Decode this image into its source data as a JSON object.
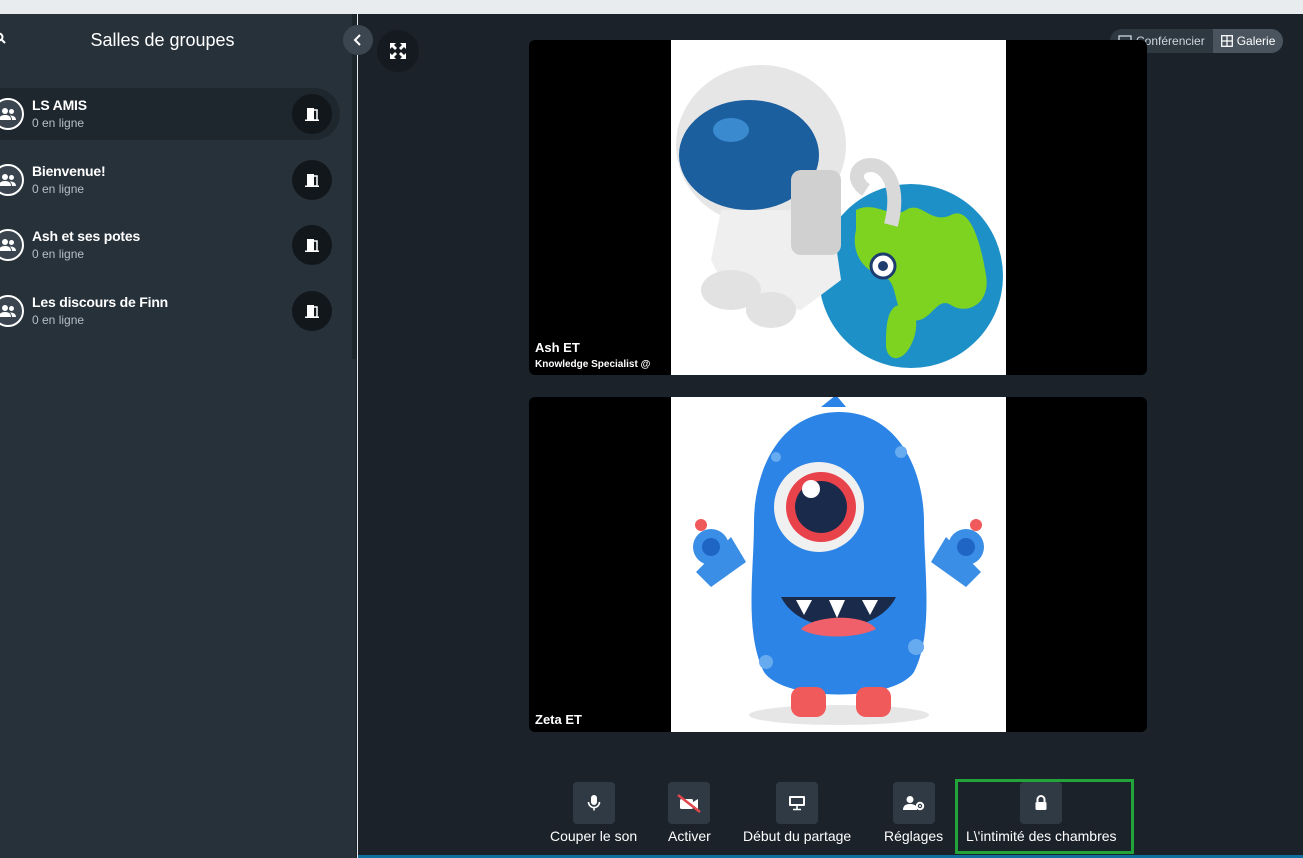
{
  "sidebar": {
    "title": "Salles de groupes",
    "rooms": [
      {
        "name": "LS AMIS",
        "status": "0 en ligne",
        "active": true
      },
      {
        "name": "Bienvenue!",
        "status": "0 en ligne",
        "active": false
      },
      {
        "name": "Ash et ses potes",
        "status": "0 en ligne",
        "active": false
      },
      {
        "name": "Les discours de Finn",
        "status": "0 en ligne",
        "active": false
      }
    ]
  },
  "view_toggle": {
    "speaker_label": "Conférencier",
    "gallery_label": "Galerie",
    "selected": "Galerie"
  },
  "participants": [
    {
      "name": "Ash ET",
      "subtitle": "Knowledge Specialist @",
      "avatar_icon": "astronaut-earth-illustration"
    },
    {
      "name": "Zeta ET",
      "subtitle": "",
      "avatar_icon": "blue-monster-illustration"
    }
  ],
  "controls": {
    "mute_label": "Couper le son",
    "video_label": "Activer",
    "share_label": "Début du partage",
    "settings_label": "Réglages",
    "privacy_label": "L\\'intimité des chambres"
  },
  "colors": {
    "accent_highlight": "#22a43a",
    "sidebar_bg": "#27313a",
    "main_bg": "#1b222a",
    "video_off": "#e0474c"
  }
}
